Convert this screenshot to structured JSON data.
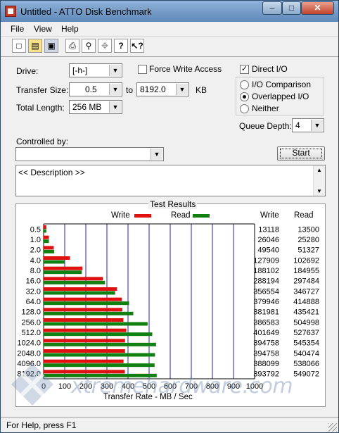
{
  "window": {
    "title": "Untitled - ATTO Disk Benchmark",
    "min": "–",
    "max": "□",
    "close": "✕"
  },
  "menu": [
    "File",
    "View",
    "Help"
  ],
  "toolbar": [
    "new-icon",
    "open-icon",
    "save-icon",
    "print-icon",
    "print-preview-icon",
    "move-icon",
    "help-icon",
    "context-help-icon"
  ],
  "form": {
    "drive_label": "Drive:",
    "drive_value": "[-h-]",
    "force_write_label": "Force Write Access",
    "direct_io_label": "Direct I/O",
    "direct_io_checked": true,
    "transfer_size_label": "Transfer Size:",
    "transfer_from": "0.5",
    "to_label": "to",
    "transfer_to": "8192.0",
    "kb_label": "KB",
    "total_length_label": "Total Length:",
    "total_length_value": "256 MB",
    "io_comparison_label": "I/O Comparison",
    "overlapped_io_label": "Overlapped I/O",
    "neither_label": "Neither",
    "queue_depth_label": "Queue Depth:",
    "queue_depth_value": "4",
    "controlled_by_label": "Controlled by:",
    "controlled_by_value": "",
    "start_label": "Start",
    "description": "<< Description >>"
  },
  "chart_data": {
    "type": "bar",
    "title": "Test Results",
    "legend": [
      "Write",
      "Read"
    ],
    "colors": {
      "write": "#e01010",
      "read": "#108010",
      "grid": "#2020b0"
    },
    "xlabel": "Transfer Rate - MB / Sec",
    "xlim": [
      0,
      1000
    ],
    "xticks": [
      "0",
      "100",
      "200",
      "300",
      "400",
      "500",
      "600",
      "700",
      "800",
      "900",
      "1000"
    ],
    "col_headers": [
      "Write",
      "Read"
    ],
    "categories": [
      "0.5",
      "1.0",
      "2.0",
      "4.0",
      "8.0",
      "16.0",
      "32.0",
      "64.0",
      "128.0",
      "256.0",
      "512.0",
      "1024.0",
      "2048.0",
      "4096.0",
      "8192.0"
    ],
    "write_kb": [
      13118,
      26046,
      49540,
      127909,
      188102,
      288194,
      356554,
      379946,
      381981,
      386583,
      401649,
      394758,
      394758,
      388099,
      393792
    ],
    "read_kb": [
      13500,
      25280,
      51327,
      102692,
      184955,
      297484,
      346727,
      414888,
      435421,
      504998,
      527637,
      545354,
      540474,
      538066,
      549072
    ],
    "write_mbs": [
      13,
      25,
      48,
      125,
      184,
      281,
      348,
      371,
      373,
      378,
      392,
      386,
      386,
      379,
      385
    ],
    "read_mbs": [
      13,
      25,
      50,
      100,
      181,
      291,
      339,
      405,
      425,
      493,
      515,
      533,
      528,
      526,
      536
    ]
  },
  "status": {
    "text": "For Help, press F1"
  },
  "watermark": "xtremehardware.com"
}
